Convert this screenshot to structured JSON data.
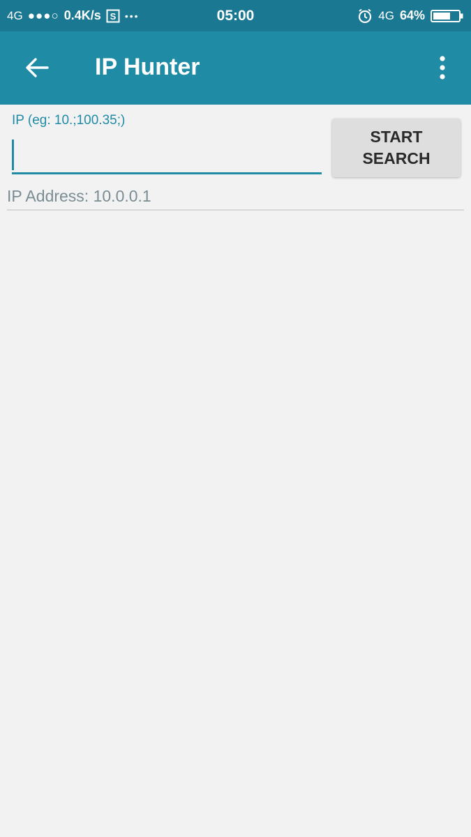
{
  "status_bar": {
    "network_left": "4G",
    "signal_dots": "●●●○",
    "speed": "0.4K/s",
    "more": "•••",
    "time": "05:00",
    "network_right": "4G",
    "battery": "64%"
  },
  "app_bar": {
    "title": "IP Hunter"
  },
  "form": {
    "ip_label": "IP (eg: 10.;100.35;)",
    "ip_value": "",
    "search_button_line1": "START",
    "search_button_line2": "SEARCH"
  },
  "result": {
    "ip_address_text": "IP Address: 10.0.0.1"
  },
  "colors": {
    "status_bar": "#1b7892",
    "app_bar": "#1f8ba5",
    "accent": "#1f8ba5",
    "background": "#f2f2f2"
  }
}
